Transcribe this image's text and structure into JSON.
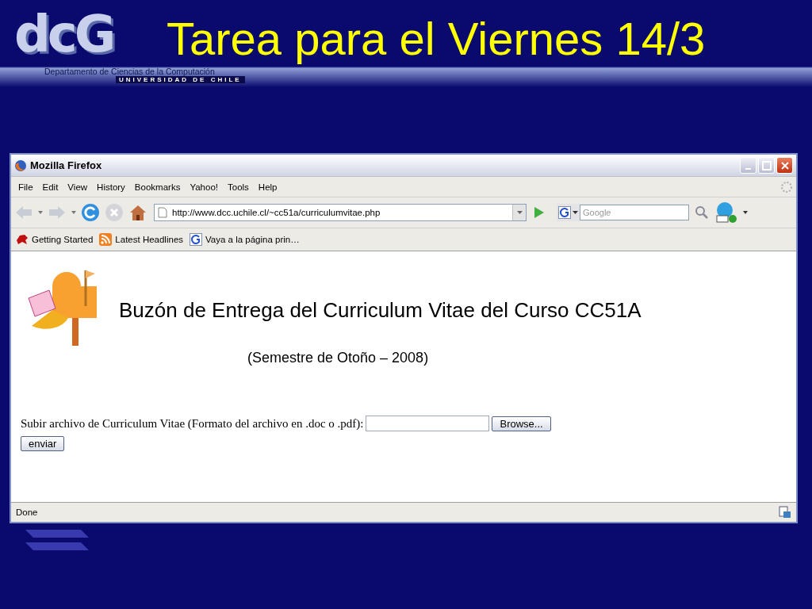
{
  "slide": {
    "logo": {
      "letters": "dcG",
      "department": "Departamento de Ciencias de la Computación",
      "university": "UNIVERSIDAD DE CHILE"
    },
    "title": "Tarea para el Viernes 14/3"
  },
  "browser": {
    "title": "Mozilla Firefox",
    "menu": [
      "File",
      "Edit",
      "View",
      "History",
      "Bookmarks",
      "Yahoo!",
      "Tools",
      "Help"
    ],
    "address": "http://www.dcc.uchile.cl/~cc51a/curriculumvitae.php",
    "search_placeholder": "Google",
    "bookmarks": [
      {
        "label": "Getting Started",
        "kind": "firefox"
      },
      {
        "label": "Latest Headlines",
        "kind": "rss"
      },
      {
        "label": "Vaya a la página prin…",
        "kind": "google"
      }
    ],
    "status": "Done"
  },
  "page": {
    "heading": "Buzón de Entrega del Curriculum Vitae del Curso CC51A",
    "subheading": "(Semestre de Otoño – 2008)",
    "upload_label": "Subir archivo de Curriculum Vitae (Formato del archivo en .doc o .pdf):",
    "browse_button": "Browse...",
    "submit_button": "enviar"
  }
}
